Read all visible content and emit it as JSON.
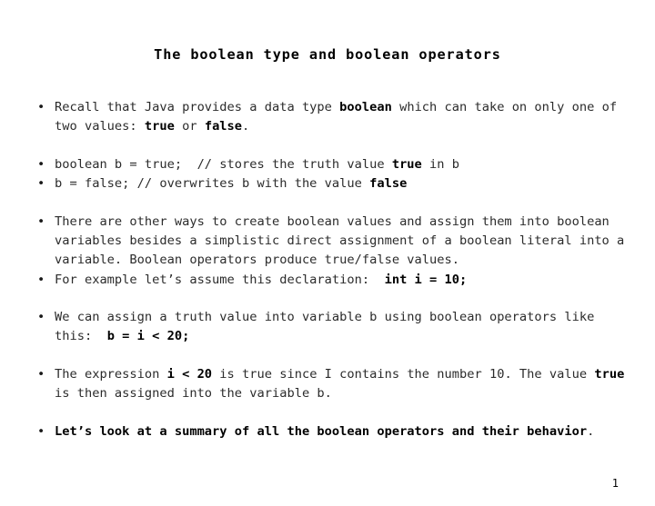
{
  "slide": {
    "title": "The boolean type and boolean operators",
    "page_number": "1",
    "bullet_marker": "•",
    "text_color": "#2b2b2b",
    "background_color": "#ffffff",
    "bullets": [
      {
        "id": "recall-boolean-type",
        "plain": "Recall that Java provides a data type boolean which can take on only one of two values: true or false.",
        "segments": [
          {
            "text": "Recall that Java provides a data type ",
            "bold": false
          },
          {
            "text": "boolean",
            "bold": true
          },
          {
            "text": " which can take on only one of two values: ",
            "bold": false
          },
          {
            "text": "true",
            "bold": true
          },
          {
            "text": " or ",
            "bold": false
          },
          {
            "text": "false",
            "bold": true
          },
          {
            "text": ".",
            "bold": false
          }
        ]
      },
      {
        "id": "declare-boolean-true",
        "plain": "boolean b = true;  // stores the truth value true in b",
        "segments": [
          {
            "text": "boolean b = true;  // stores the truth value ",
            "bold": false
          },
          {
            "text": "true",
            "bold": true
          },
          {
            "text": " in b",
            "bold": false
          }
        ]
      },
      {
        "id": "assign-boolean-false",
        "plain": "b = false; // overwrites b with the value false",
        "segments": [
          {
            "text": "b = false; // overwrites b with the value ",
            "bold": false
          },
          {
            "text": "false",
            "bold": true
          }
        ]
      },
      {
        "id": "other-ways-to-create",
        "plain": "There are other ways to create boolean values and assign them into boolean variables besides a simplistic direct assignment of a boolean literal into a variable. Boolean operators produce true/false values.",
        "segments": [
          {
            "text": "There are other ways to create boolean values and assign them into boolean variables besides a simplistic direct assignment of a boolean literal into a variable. Boolean operators produce true/false values.",
            "bold": false
          }
        ]
      },
      {
        "id": "example-declaration",
        "plain": "For example let’s assume this declaration:  int i = 10;",
        "segments": [
          {
            "text": "For example let’s assume this declaration:  ",
            "bold": false
          },
          {
            "text": "int i = 10;",
            "bold": true
          }
        ]
      },
      {
        "id": "assign-truth-value",
        "plain": "We can assign a truth value into variable b using boolean operators like this:  b = i < 20;",
        "segments": [
          {
            "text": "We can assign a truth value into variable b using boolean operators like this:  ",
            "bold": false
          },
          {
            "text": "b = i < 20;",
            "bold": true
          }
        ]
      },
      {
        "id": "expression-is-true",
        "plain": "The expression i < 20 is true since I contains the number 10. The value true is then assigned into the variable b.",
        "segments": [
          {
            "text": "The expression ",
            "bold": false
          },
          {
            "text": "i < 20",
            "bold": true
          },
          {
            "text": " is true since I contains the number 10. The value ",
            "bold": false
          },
          {
            "text": "true",
            "bold": true
          },
          {
            "text": " is then assigned into the variable b.",
            "bold": false
          }
        ]
      },
      {
        "id": "summary-lead-in",
        "plain": "Let’s look at a summary of all the boolean operators and their behavior.",
        "segments": [
          {
            "text": "Let’s look at a summary of all the boolean operators and their behavior",
            "bold": true
          },
          {
            "text": ".",
            "bold": false
          }
        ]
      }
    ],
    "spacers": {
      "after_0": "gap-lg",
      "after_1": "gap-xs",
      "after_2": "gap-lg",
      "after_3": "gap-xs",
      "after_4": "gap-lg",
      "after_5": "gap-lg",
      "after_6": "gap-lg"
    }
  }
}
